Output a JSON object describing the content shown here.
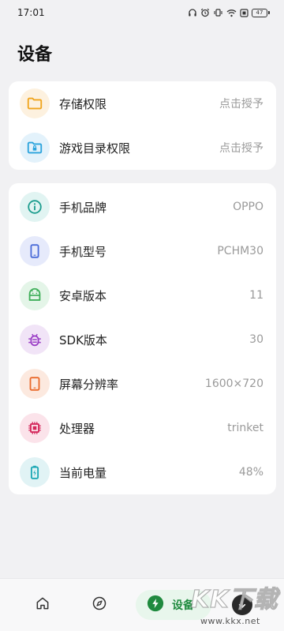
{
  "status_bar": {
    "time": "17:01",
    "battery_level": "47"
  },
  "page": {
    "title": "设备"
  },
  "permissions": [
    {
      "icon": "folder-icon",
      "label": "存储权限",
      "value": "点击授予"
    },
    {
      "icon": "folder-lock-icon",
      "label": "游戏目录权限",
      "value": "点击授予"
    }
  ],
  "device_info": [
    {
      "icon": "info-icon",
      "label": "手机品牌",
      "value": "OPPO"
    },
    {
      "icon": "phone-icon",
      "label": "手机型号",
      "value": "PCHM30"
    },
    {
      "icon": "android-icon",
      "label": "安卓版本",
      "value": "11"
    },
    {
      "icon": "bug-icon",
      "label": "SDK版本",
      "value": "30"
    },
    {
      "icon": "tablet-icon",
      "label": "屏幕分辨率",
      "value": "1600×720"
    },
    {
      "icon": "chip-icon",
      "label": "处理器",
      "value": "trinket"
    },
    {
      "icon": "battery-charging-icon",
      "label": "当前电量",
      "value": "48%"
    }
  ],
  "bottom_nav": {
    "home": {
      "icon": "home-icon"
    },
    "discover": {
      "icon": "compass-icon"
    },
    "device": {
      "icon": "bolt-icon",
      "label": "设备",
      "active": true
    },
    "download": {
      "icon": "download-icon"
    }
  },
  "watermark": {
    "logo": "KK下载",
    "url": "www.kkx.net"
  },
  "colors": {
    "background": "#f1f1f3",
    "card": "#ffffff",
    "accent_green": "#1f8a3e",
    "value_gray": "#9a9a9a"
  }
}
